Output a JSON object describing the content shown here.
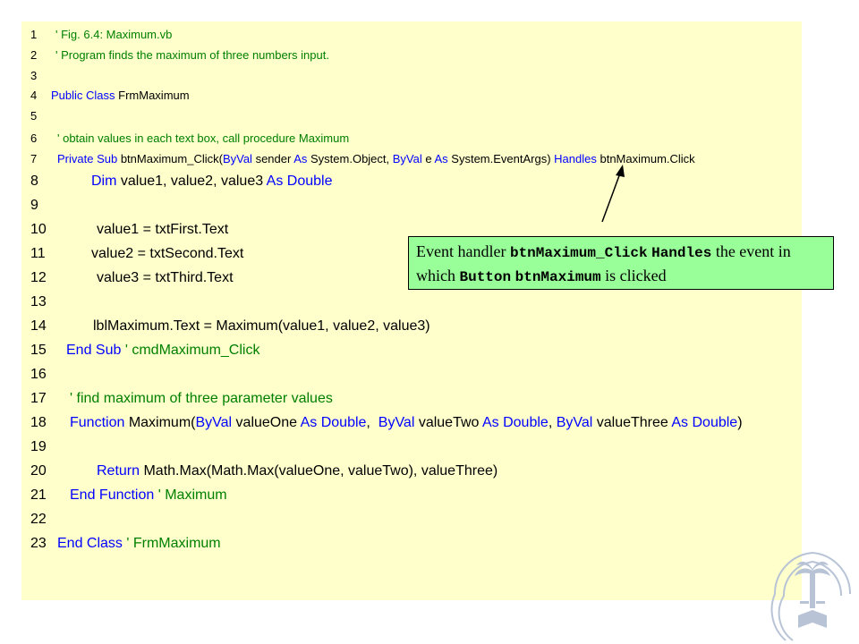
{
  "code_lines": [
    {
      "num": "1",
      "tokens": [
        {
          "t": "' Fig. 6.4: Maximum.vb",
          "c": "c"
        }
      ]
    },
    {
      "num": "2",
      "tokens": [
        {
          "t": "' Program finds the maximum of three numbers input.",
          "c": "c"
        }
      ]
    },
    {
      "num": "3",
      "tokens": []
    },
    {
      "num": "4",
      "tokens": [
        {
          "t": "Public Class",
          "c": "k"
        },
        {
          "t": " FrmMaximum",
          "c": ""
        }
      ]
    },
    {
      "num": "5",
      "tokens": []
    },
    {
      "num": "6",
      "tokens": [
        {
          "t": "' obtain values in each text box, call procedure Maximum",
          "c": "c"
        }
      ]
    },
    {
      "num": "7",
      "tokens": [
        {
          "t": "Private Sub",
          "c": "k"
        },
        {
          "t": " btnMaximum_Click(",
          "c": ""
        },
        {
          "t": "ByVal",
          "c": "k"
        },
        {
          "t": " sender ",
          "c": ""
        },
        {
          "t": "As",
          "c": "k"
        },
        {
          "t": " System.Object, ",
          "c": ""
        },
        {
          "t": "ByVal",
          "c": "k"
        },
        {
          "t": " e ",
          "c": ""
        },
        {
          "t": "As",
          "c": "k"
        },
        {
          "t": " System.EventArgs) ",
          "c": ""
        },
        {
          "t": "Handles",
          "c": "k"
        },
        {
          "t": " btnMaximum.Click",
          "c": ""
        }
      ]
    },
    {
      "num": "8",
      "tokens": [
        {
          "t": "Dim",
          "c": "k"
        },
        {
          "t": " value1, value2, value3 ",
          "c": ""
        },
        {
          "t": "As Double",
          "c": "k"
        }
      ]
    },
    {
      "num": "9",
      "tokens": []
    },
    {
      "num": "10",
      "tokens": [
        {
          "t": "value1 = txtFirst.Text",
          "c": ""
        }
      ]
    },
    {
      "num": "11",
      "tokens": [
        {
          "t": "value2 = txtSecond.Text",
          "c": ""
        }
      ]
    },
    {
      "num": "12",
      "tokens": [
        {
          "t": "value3 = txtThird.Text",
          "c": ""
        }
      ]
    },
    {
      "num": "13",
      "tokens": []
    },
    {
      "num": "14",
      "tokens": [
        {
          "t": "lblMaximum.Text = Maximum(value1, value2, value3)",
          "c": ""
        }
      ]
    },
    {
      "num": "15",
      "tokens": [
        {
          "t": "End Sub",
          "c": "k"
        },
        {
          "t": " ' cmdMaximum_Click",
          "c": "c"
        }
      ]
    },
    {
      "num": "16",
      "tokens": []
    },
    {
      "num": "17",
      "tokens": [
        {
          "t": "' find maximum of three parameter values",
          "c": "c"
        }
      ]
    },
    {
      "num": "18",
      "tokens": [
        {
          "t": "Function",
          "c": "k"
        },
        {
          "t": " Maximum(",
          "c": ""
        },
        {
          "t": "ByVal",
          "c": "k"
        },
        {
          "t": " valueOne ",
          "c": ""
        },
        {
          "t": "As Double",
          "c": "k"
        },
        {
          "t": ",  ",
          "c": ""
        },
        {
          "t": "ByVal",
          "c": "k"
        },
        {
          "t": " valueTwo ",
          "c": ""
        },
        {
          "t": "As Double",
          "c": "k"
        },
        {
          "t": ", ",
          "c": ""
        },
        {
          "t": "ByVal",
          "c": "k"
        },
        {
          "t": " valueThree ",
          "c": ""
        },
        {
          "t": "As Double",
          "c": "k"
        },
        {
          "t": ")",
          "c": ""
        }
      ]
    },
    {
      "num": "19",
      "tokens": []
    },
    {
      "num": "20",
      "tokens": [
        {
          "t": "Return",
          "c": "k"
        },
        {
          "t": " Math.Max(Math.Max(valueOne, valueTwo), valueThree)",
          "c": ""
        }
      ]
    },
    {
      "num": "21",
      "tokens": [
        {
          "t": "End Function",
          "c": "k"
        },
        {
          "t": " ' Maximum",
          "c": "c"
        }
      ]
    },
    {
      "num": "22",
      "tokens": []
    },
    {
      "num": "23",
      "tokens": [
        {
          "t": "End Class",
          "c": "k"
        },
        {
          "t": " ' FrmMaximum",
          "c": "c"
        }
      ]
    }
  ],
  "callout": {
    "p1": "Event handler ",
    "code1": "btnMaximum_Click",
    "sp1": " ",
    "code2": "Handles",
    "p2": " the event in which ",
    "code3": "Button",
    "sp2": " ",
    "code4": "btnMaximum",
    "p3": " is clicked"
  },
  "colors": {
    "panel_bg": "#ffffcc",
    "comment": "#008000",
    "keyword": "#0000ff",
    "callout_bg": "#99ff99"
  },
  "logo": {
    "icon": "university-seal-icon"
  }
}
